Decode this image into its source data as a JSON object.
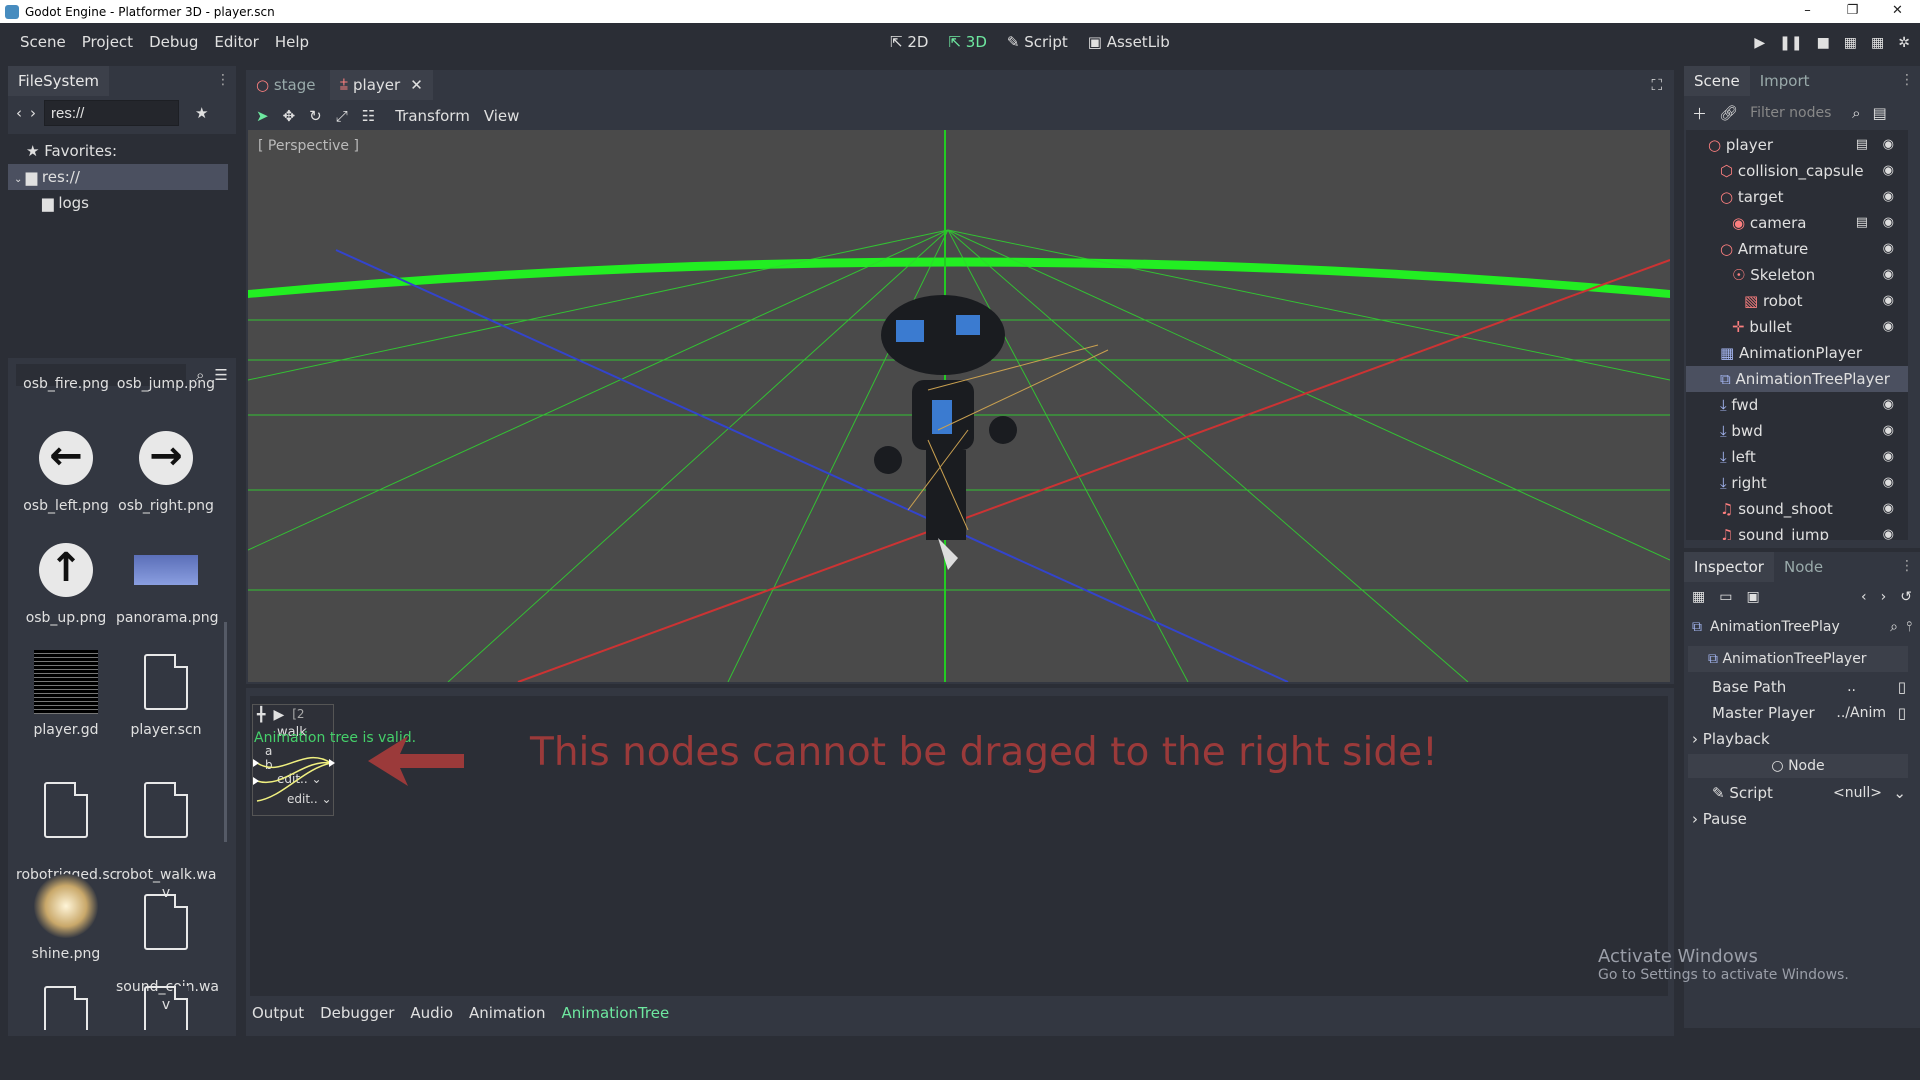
{
  "window": {
    "title": "Godot Engine - Platformer 3D - player.scn",
    "controls": [
      "–",
      "❐",
      "✕"
    ]
  },
  "menu": {
    "items": [
      "Scene",
      "Project",
      "Debug",
      "Editor",
      "Help"
    ]
  },
  "main_modes": {
    "items": [
      "2D",
      "3D",
      "Script",
      "AssetLib"
    ],
    "active": "3D"
  },
  "filesystem": {
    "tab": "FileSystem",
    "path": "res://",
    "tree": [
      {
        "label": "Favorites:",
        "icon": "star-icon"
      },
      {
        "label": "res://",
        "icon": "folder-icon"
      },
      {
        "label": "logs",
        "icon": "folder-icon"
      }
    ],
    "files": [
      {
        "name": "osb_fire.png"
      },
      {
        "name": "osb_jump.png"
      },
      {
        "name": "osb_left.png",
        "glyph": "←"
      },
      {
        "name": "osb_right.png",
        "glyph": "→"
      },
      {
        "name": "osb_up.png",
        "glyph": "↑"
      },
      {
        "name": "panorama.png"
      },
      {
        "name": "player.gd"
      },
      {
        "name": "player.scn"
      },
      {
        "name": "robotrigged.sc\nn"
      },
      {
        "name": "robot_walk.wa\nv"
      },
      {
        "name": "shine.png"
      },
      {
        "name": "sound_coin.wa\nv"
      }
    ]
  },
  "scene_tabs": {
    "tabs": [
      "stage",
      "player"
    ],
    "active": "player"
  },
  "viewport": {
    "toolbar": {
      "menus": [
        "Transform",
        "View"
      ]
    },
    "label": "[ Perspective ]"
  },
  "animation_tree": {
    "status": "Animation tree is valid.",
    "node_title": "walk",
    "inputs": [
      "a",
      "b"
    ],
    "edit_labels": [
      "edit..",
      "edit.."
    ],
    "top_label": "[2",
    "annotation": "This nodes cannot be draged to the right side!",
    "annotation_color": "#9b3a3a"
  },
  "bottom_tabs": {
    "items": [
      "Output",
      "Debugger",
      "Audio",
      "Animation",
      "AnimationTree"
    ],
    "active": "AnimationTree"
  },
  "scene_dock": {
    "tabs": [
      "Scene",
      "Import"
    ],
    "filter_placeholder": "Filter nodes",
    "nodes": [
      {
        "label": "player",
        "depth": 0,
        "icon": "spatial-icon",
        "color": "#fc7f7f",
        "script": true,
        "eye": true
      },
      {
        "label": "collision_capsule",
        "depth": 1,
        "icon": "collision-icon",
        "color": "#fc7f7f",
        "eye": true
      },
      {
        "label": "target",
        "depth": 1,
        "icon": "spatial-icon",
        "color": "#fc7f7f",
        "eye": true
      },
      {
        "label": "camera",
        "depth": 2,
        "icon": "camera-icon",
        "color": "#fc7f7f",
        "script": true,
        "eye": true
      },
      {
        "label": "Armature",
        "depth": 1,
        "icon": "spatial-icon",
        "color": "#fc7f7f",
        "eye": true
      },
      {
        "label": "Skeleton",
        "depth": 2,
        "icon": "skeleton-icon",
        "color": "#fc7f7f",
        "eye": true
      },
      {
        "label": "robot",
        "depth": 3,
        "icon": "mesh-icon",
        "color": "#fc7f7f",
        "eye": true
      },
      {
        "label": "bullet",
        "depth": 2,
        "icon": "position-icon",
        "color": "#fc7f7f",
        "eye": true
      },
      {
        "label": "AnimationPlayer",
        "depth": 1,
        "icon": "animation-player-icon",
        "color": "#a5b7f3",
        "eye": false
      },
      {
        "label": "AnimationTreePlayer",
        "depth": 1,
        "icon": "animation-tree-icon",
        "color": "#a5b7f3",
        "eye": false,
        "selected": true
      },
      {
        "label": "fwd",
        "depth": 1,
        "icon": "raycast-icon",
        "color": "#a5b7f3",
        "eye": true
      },
      {
        "label": "bwd",
        "depth": 1,
        "icon": "raycast-icon",
        "color": "#a5b7f3",
        "eye": true
      },
      {
        "label": "left",
        "depth": 1,
        "icon": "raycast-icon",
        "color": "#a5b7f3",
        "eye": true
      },
      {
        "label": "right",
        "depth": 1,
        "icon": "raycast-icon",
        "color": "#a5b7f3",
        "eye": true
      },
      {
        "label": "sound_shoot",
        "depth": 1,
        "icon": "audio-icon",
        "color": "#fc7f7f",
        "eye": true
      },
      {
        "label": "sound_jump",
        "depth": 1,
        "icon": "audio-icon",
        "color": "#fc7f7f",
        "eye": true
      }
    ]
  },
  "inspector": {
    "tabs": [
      "Inspector",
      "Node"
    ],
    "object_name": "AnimationTreePlay",
    "header": "AnimationTreePlayer",
    "properties": [
      {
        "label": "Base Path",
        "value": ".."
      },
      {
        "label": "Master Player",
        "value": "../Anim"
      }
    ],
    "sections": [
      "Playback",
      "Pause"
    ],
    "node_section": "Node",
    "script_label": "Script",
    "script_value": "<null>"
  },
  "watermark": {
    "title": "Activate Windows",
    "subtitle": "Go to Settings to activate Windows."
  }
}
